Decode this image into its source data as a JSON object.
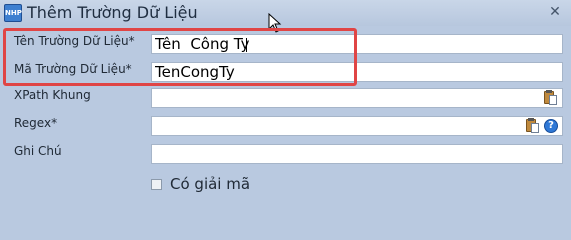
{
  "window": {
    "title": "Thêm Trường Dữ Liệu",
    "app_icon": "app-icon",
    "close_icon": "close-x-icon"
  },
  "form": {
    "fields": [
      {
        "label": "Tên Trường Dữ Liệu*",
        "value": "Tên  Công Ty",
        "icons": []
      },
      {
        "label": "Mã Trường Dữ Liệu*",
        "value": "TenCongTy",
        "icons": []
      },
      {
        "label": "XPath Khung",
        "value": "",
        "icons": [
          "paste-icon"
        ]
      },
      {
        "label": "Regex*",
        "value": "",
        "icons": [
          "paste-icon",
          "help-icon"
        ]
      },
      {
        "label": "Ghi Chú",
        "value": "",
        "icons": []
      }
    ],
    "decode_checkbox": {
      "label": "Có giải mã",
      "checked": false
    }
  },
  "annotation": {
    "highlight_color": "#e04545"
  },
  "colors": {
    "background": "#b9c9e0",
    "field_border": "#a6b5c9"
  }
}
